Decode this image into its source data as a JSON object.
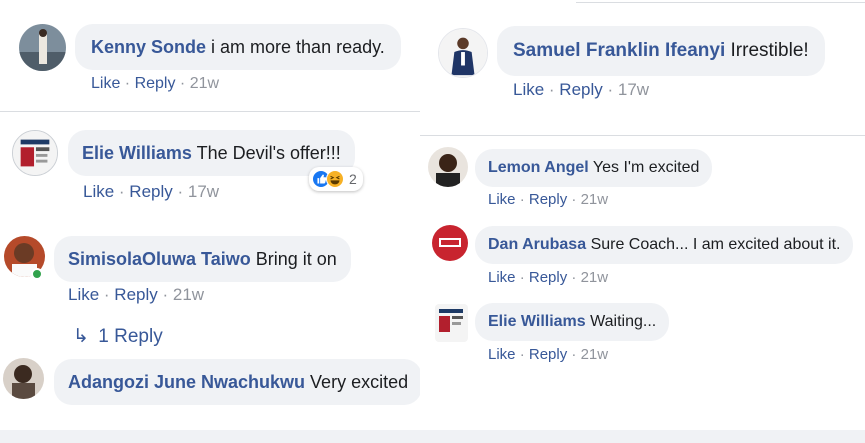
{
  "left": {
    "comments": [
      {
        "name": "Kenny Sonde",
        "text": "i am more than ready.",
        "actions": {
          "like": "Like",
          "reply": "Reply",
          "time": "21w"
        }
      },
      {
        "name": "Elie Williams",
        "text": "The Devil's offer!!!",
        "actions": {
          "like": "Like",
          "reply": "Reply",
          "time": "17w"
        },
        "reactions": {
          "count": "2",
          "icons": [
            "like-reaction-icon",
            "haha-reaction-icon"
          ]
        }
      },
      {
        "name": "SimisolaOluwa Taiwo",
        "text": "Bring it on",
        "actions": {
          "like": "Like",
          "reply": "Reply",
          "time": "21w"
        },
        "replies": "1 Reply"
      },
      {
        "name": "Adangozi June Nwachukwu",
        "text": "Very excited"
      }
    ]
  },
  "right": {
    "comments": [
      {
        "name": "Samuel Franklin Ifeanyi",
        "text": "Irrestible!",
        "actions": {
          "like": "Like",
          "reply": "Reply",
          "time": "17w"
        }
      },
      {
        "name": "Lemon Angel",
        "text": "Yes I'm excited",
        "actions": {
          "like": "Like",
          "reply": "Reply",
          "time": "21w"
        }
      },
      {
        "name": "Dan Arubasa",
        "text": "Sure Coach... I am excited about it.",
        "actions": {
          "like": "Like",
          "reply": "Reply",
          "time": "21w"
        }
      },
      {
        "name": "Elie Williams",
        "text": "Waiting...",
        "actions": {
          "like": "Like",
          "reply": "Reply",
          "time": "21w"
        }
      }
    ]
  },
  "separator": " · ",
  "colors": {
    "link": "#385898",
    "meta": "#90949c",
    "bubble": "#f0f2f5",
    "online": "#31a24c",
    "like": "#1877f2",
    "haha": "#f7b125"
  }
}
